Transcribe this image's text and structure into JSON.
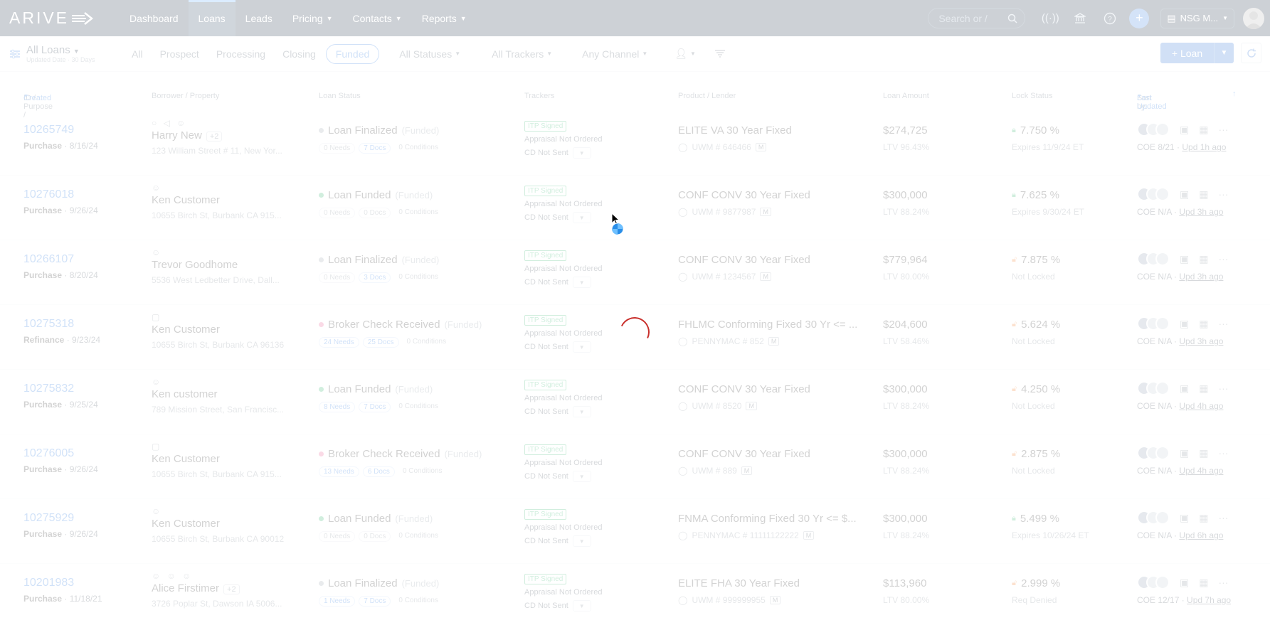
{
  "nav": {
    "logo": "ARIVE",
    "items": [
      {
        "label": "Dashboard",
        "active": false,
        "has_menu": false
      },
      {
        "label": "Loans",
        "active": true,
        "has_menu": false
      },
      {
        "label": "Leads",
        "active": false,
        "has_menu": false
      },
      {
        "label": "Pricing",
        "active": false,
        "has_menu": true
      },
      {
        "label": "Contacts",
        "active": false,
        "has_menu": true
      },
      {
        "label": "Reports",
        "active": false,
        "has_menu": true
      }
    ],
    "search_placeholder": "Search or /",
    "company": "NSG M...",
    "icons": [
      "search-icon",
      "broadcast-icon",
      "bank-icon",
      "help-icon",
      "plus-icon",
      "building-icon"
    ]
  },
  "filterbar": {
    "title": "All Loans",
    "subtitle": "Updated Date · 30 Days",
    "tabs": [
      "All",
      "Prospect",
      "Processing",
      "Closing",
      "Funded"
    ],
    "active_tab": "Funded",
    "status_filter": "All Statuses",
    "tracker_filter": "All Trackers",
    "channel_filter": "Any Channel",
    "add_loan_label": "+ Loan"
  },
  "table_headers": {
    "id": "ID / Purpose /",
    "created": "Created",
    "borrower": "Borrower / Property",
    "status": "Loan Status",
    "trackers": "Trackers",
    "product": "Product / Lender",
    "amount": "Loan Amount",
    "lock": "Lock Status",
    "sort_by": "Sort by:",
    "sort_value": "Last Updated"
  },
  "loans": [
    {
      "id": "10265749",
      "purpose": "Purchase",
      "date": "8/16/24",
      "borrower": "Harry New",
      "extra": "+2",
      "icons": "○ ◁ ☺",
      "address": "123 William Street # 11, New Yor...",
      "status": "Loan Finalized",
      "status_color": "grey",
      "stage": "(Funded)",
      "needs": "0 Needs",
      "needs_blue": false,
      "docs": "7 Docs",
      "docs_blue": true,
      "conditions": "0 Conditions",
      "tracker1": "ITP Signed",
      "tracker2": "Appraisal Not Ordered",
      "tracker3": "CD Not Sent",
      "product": "ELITE VA 30 Year Fixed",
      "lender": "UWM # 646466",
      "amount": "$274,725",
      "ltv": "LTV 96.43%",
      "rate": "7.750 %",
      "locked": true,
      "lock_sub": "Expires 11/9/24 ET",
      "coe": "COE 8/21",
      "updated": "Upd 1h ago"
    },
    {
      "id": "10276018",
      "purpose": "Purchase",
      "date": "9/26/24",
      "borrower": "Ken Customer",
      "extra": "",
      "icons": "☺",
      "address": "10655 Birch St, Burbank CA 915...",
      "status": "Loan Funded",
      "status_color": "green",
      "stage": "(Funded)",
      "needs": "0 Needs",
      "needs_blue": false,
      "docs": "0 Docs",
      "docs_blue": false,
      "conditions": "0 Conditions",
      "tracker1": "ITP Signed",
      "tracker2": "Appraisal Not Ordered",
      "tracker3": "CD Not Sent",
      "product": "CONF CONV 30 Year Fixed",
      "lender": "UWM # 9877987",
      "amount": "$300,000",
      "ltv": "LTV 88.24%",
      "rate": "7.625 %",
      "locked": true,
      "lock_sub": "Expires 9/30/24 ET",
      "coe": "COE N/A",
      "updated": "Upd 3h ago"
    },
    {
      "id": "10266107",
      "purpose": "Purchase",
      "date": "8/20/24",
      "borrower": "Trevor Goodhome",
      "extra": "",
      "icons": "☺",
      "address": "5536 West Ledbetter Drive, Dall...",
      "status": "Loan Finalized",
      "status_color": "grey",
      "stage": "(Funded)",
      "needs": "0 Needs",
      "needs_blue": false,
      "docs": "3 Docs",
      "docs_blue": true,
      "conditions": "0 Conditions",
      "tracker1": "ITP Signed",
      "tracker2": "Appraisal Not Ordered",
      "tracker3": "CD Not Sent",
      "product": "CONF CONV 30 Year Fixed",
      "lender": "UWM # 1234567",
      "amount": "$779,964",
      "ltv": "LTV 80.00%",
      "rate": "7.875 %",
      "locked": false,
      "lock_sub": "Not Locked",
      "coe": "COE N/A",
      "updated": "Upd 3h ago"
    },
    {
      "id": "10275318",
      "purpose": "Refinance",
      "date": "9/23/24",
      "borrower": "Ken Customer",
      "extra": "",
      "icons": "▢",
      "address": "10655 Birch St, Burbank CA 96136",
      "status": "Broker Check Received",
      "status_color": "pink",
      "stage": "(Funded)",
      "needs": "24 Needs",
      "needs_blue": true,
      "docs": "25 Docs",
      "docs_blue": true,
      "conditions": "0 Conditions",
      "tracker1": "ITP Signed",
      "tracker2": "Appraisal Not Ordered",
      "tracker3": "CD Not Sent",
      "product": "FHLMC Conforming Fixed 30 Yr <= ...",
      "lender": "PENNYMAC # 852",
      "amount": "$204,600",
      "ltv": "LTV 58.46%",
      "rate": "5.624 %",
      "locked": false,
      "lock_sub": "Not Locked",
      "coe": "COE N/A",
      "updated": "Upd 3h ago"
    },
    {
      "id": "10275832",
      "purpose": "Purchase",
      "date": "9/25/24",
      "borrower": "Ken customer",
      "extra": "",
      "icons": "☺",
      "address": "789 Mission Street, San Francisc...",
      "status": "Loan Funded",
      "status_color": "green",
      "stage": "(Funded)",
      "needs": "8 Needs",
      "needs_blue": true,
      "docs": "7 Docs",
      "docs_blue": true,
      "conditions": "0 Conditions",
      "tracker1": "ITP Signed",
      "tracker2": "Appraisal Not Ordered",
      "tracker3": "CD Not Sent",
      "product": "CONF CONV 30 Year Fixed",
      "lender": "UWM # 8520",
      "amount": "$300,000",
      "ltv": "LTV 88.24%",
      "rate": "4.250 %",
      "locked": false,
      "lock_sub": "Not Locked",
      "coe": "COE N/A",
      "updated": "Upd 4h ago"
    },
    {
      "id": "10276005",
      "purpose": "Purchase",
      "date": "9/26/24",
      "borrower": "Ken Customer",
      "extra": "",
      "icons": "▢",
      "address": "10655 Birch St, Burbank CA 915...",
      "status": "Broker Check Received",
      "status_color": "pink",
      "stage": "(Funded)",
      "needs": "13 Needs",
      "needs_blue": true,
      "docs": "6 Docs",
      "docs_blue": true,
      "conditions": "0 Conditions",
      "tracker1": "ITP Signed",
      "tracker2": "Appraisal Not Ordered",
      "tracker3": "CD Not Sent",
      "product": "CONF CONV 30 Year Fixed",
      "lender": "UWM # 889",
      "amount": "$300,000",
      "ltv": "LTV 88.24%",
      "rate": "2.875 %",
      "locked": false,
      "lock_sub": "Not Locked",
      "coe": "COE N/A",
      "updated": "Upd 4h ago"
    },
    {
      "id": "10275929",
      "purpose": "Purchase",
      "date": "9/26/24",
      "borrower": "Ken Customer",
      "extra": "",
      "icons": "☺",
      "address": "10655 Birch St, Burbank CA 90012",
      "status": "Loan Funded",
      "status_color": "green",
      "stage": "(Funded)",
      "needs": "0 Needs",
      "needs_blue": false,
      "docs": "0 Docs",
      "docs_blue": false,
      "conditions": "0 Conditions",
      "tracker1": "ITP Signed",
      "tracker2": "Appraisal Not Ordered",
      "tracker3": "CD Not Sent",
      "product": "FNMA Conforming Fixed 30 Yr <= $...",
      "lender": "PENNYMAC # 11111122222",
      "amount": "$300,000",
      "ltv": "LTV 88.24%",
      "rate": "5.499 %",
      "locked": true,
      "lock_sub": "Expires 10/26/24 ET",
      "coe": "COE N/A",
      "updated": "Upd 6h ago"
    },
    {
      "id": "10201983",
      "purpose": "Purchase",
      "date": "11/18/21",
      "borrower": "Alice Firstimer",
      "extra": "+2",
      "icons": "☺ ☺ ☺",
      "address": "3726 Poplar St, Dawson IA 5006...",
      "status": "Loan Finalized",
      "status_color": "grey",
      "stage": "(Funded)",
      "needs": "1 Needs",
      "needs_blue": true,
      "docs": "7 Docs",
      "docs_blue": true,
      "conditions": "0 Conditions",
      "tracker1": "ITP Signed",
      "tracker2": "Appraisal Not Ordered",
      "tracker3": "CD Not Sent",
      "product": "ELITE FHA 30 Year Fixed",
      "lender": "UWM # 999999955",
      "amount": "$113,960",
      "ltv": "LTV 80.00%",
      "rate": "2.999 %",
      "locked": false,
      "lock_sub": "Req Denied",
      "coe": "COE 12/17",
      "updated": "Upd 7h ago"
    }
  ],
  "loading": true
}
